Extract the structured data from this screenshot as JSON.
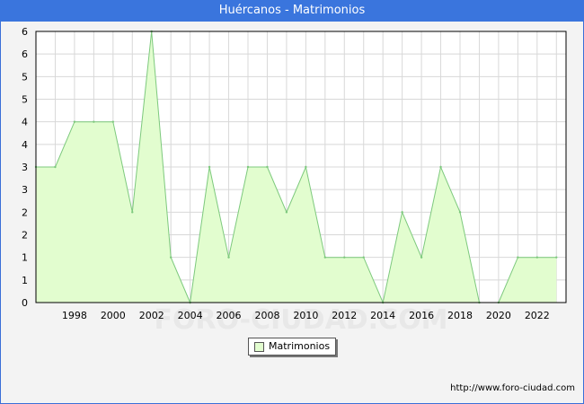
{
  "title": "Huércanos - Matrimonios",
  "footer": "http://www.foro-ciudad.com",
  "watermark": "FORO-CIUDAD.COM",
  "colors": {
    "title_bar": "#3a75dd",
    "area_fill": "#e2fdcf",
    "area_line": "#7dc97d",
    "grid": "#d8d8d8",
    "plot_bg": "#ffffff",
    "frame_bg": "#f3f3f3"
  },
  "chart_data": {
    "type": "area",
    "title": "Huércanos - Matrimonios",
    "xlabel": "",
    "ylabel": "",
    "ylim": [
      0,
      6
    ],
    "grid": true,
    "legend_position": "bottom-center",
    "x": [
      1996,
      1997,
      1998,
      1999,
      2000,
      2001,
      2002,
      2003,
      2004,
      2005,
      2006,
      2007,
      2008,
      2009,
      2010,
      2011,
      2012,
      2013,
      2014,
      2015,
      2016,
      2017,
      2018,
      2019,
      2020,
      2021,
      2022,
      2023
    ],
    "series": [
      {
        "name": "Matrimonios",
        "values": [
          3,
          3,
          4,
          4,
          4,
          2,
          6,
          1,
          0,
          3,
          1,
          3,
          3,
          2,
          3,
          1,
          1,
          1,
          0,
          2,
          1,
          3,
          2,
          0,
          0,
          1,
          1,
          1
        ]
      }
    ],
    "x_ticks": [
      "1998",
      "2000",
      "2002",
      "2004",
      "2006",
      "2008",
      "2010",
      "2012",
      "2014",
      "2016",
      "2018",
      "2020",
      "2022"
    ],
    "y_tick_labels": [
      "0",
      "1",
      "1",
      "2",
      "2",
      "3",
      "3",
      "4",
      "4",
      "5",
      "5",
      "6",
      "6"
    ]
  }
}
